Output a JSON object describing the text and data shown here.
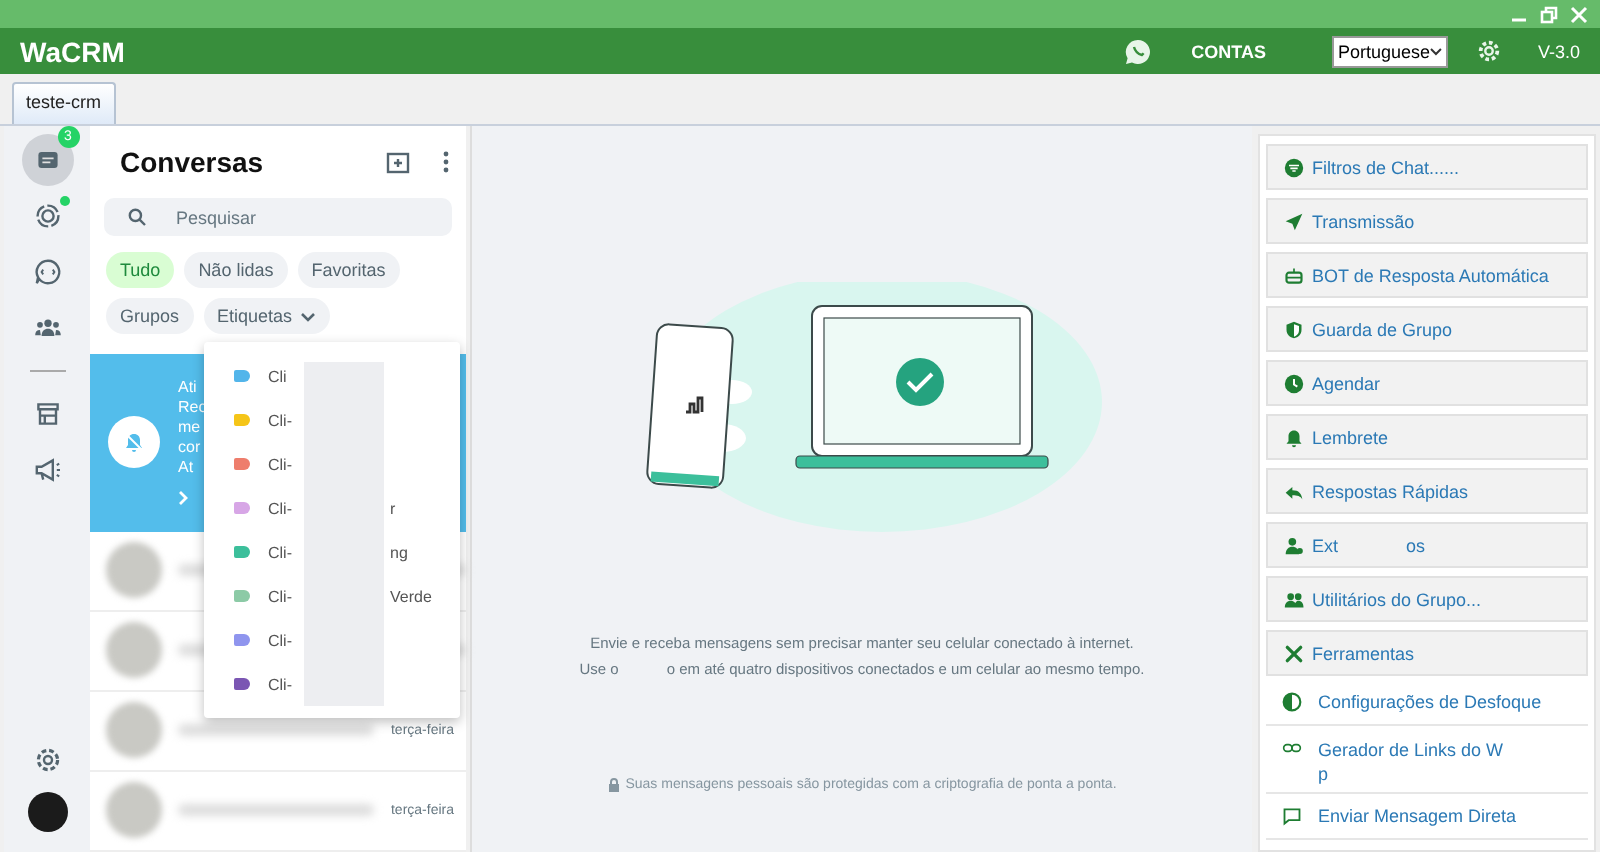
{
  "window": {
    "title": "WaCRM"
  },
  "header": {
    "contas": "CONTAS",
    "language": "Portuguese",
    "version": "V-3.0"
  },
  "tabs": [
    {
      "label": "teste-crm",
      "selected": true
    }
  ],
  "rail": {
    "items": [
      {
        "kind": "chats",
        "selected": true,
        "badge": "3"
      },
      {
        "kind": "status",
        "selected": false,
        "dot": true
      },
      {
        "kind": "channels",
        "selected": false
      },
      {
        "kind": "communities",
        "selected": false
      },
      {
        "kind": "store",
        "selected": false
      },
      {
        "kind": "megaphone",
        "selected": false
      }
    ]
  },
  "chat_panel": {
    "title": "Conversas",
    "search": {
      "placeholder": "Pesquisar"
    },
    "filters": [
      {
        "label": "Tudo",
        "selected": true,
        "dropdown": false
      },
      {
        "label": "Não lidas",
        "selected": false,
        "dropdown": false
      },
      {
        "label": "Favoritas",
        "selected": false,
        "dropdown": false
      },
      {
        "label": "Grupos",
        "selected": false,
        "dropdown": false
      },
      {
        "label": "Etiquetas",
        "selected": false,
        "dropdown": true
      }
    ],
    "banner_lines": [
      "Ati",
      "Rec",
      "me",
      "cor",
      "At"
    ],
    "chats": [
      {
        "kind": "blurred"
      },
      {
        "kind": "blurred"
      },
      {
        "kind": "blurred",
        "time": "terça-feira"
      },
      {
        "kind": "blurred",
        "time": "terça-feira"
      }
    ],
    "labels_menu": [
      {
        "text": "Cli",
        "color": "#53b5ea"
      },
      {
        "text": "Cli-",
        "color": "#f5c518"
      },
      {
        "text": "Cli-",
        "color": "#ee7d6c"
      },
      {
        "text": "Cli-",
        "suffix": "r",
        "color": "#d7a6e6"
      },
      {
        "text": "Cli-",
        "suffix": "ng",
        "color": "#3cbf9b"
      },
      {
        "text": "Cli-",
        "suffix": "Verde",
        "color": "#8ccaa6"
      },
      {
        "text": "Cli-",
        "color": "#8f95ee"
      },
      {
        "text": "Cli-",
        "color": "#7b56b3"
      }
    ]
  },
  "main": {
    "line_1": "Envie e receba mensagens sem precisar manter seu celular conectado à internet.",
    "line_2_start": "Use o",
    "line_2_end": "o em até quatro dispositivos conectados e um celular ao mesmo tempo.",
    "footer": "Suas mensagens pessoais são protegidas com a criptografia de ponta a ponta."
  },
  "tools": [
    {
      "kind": "button",
      "label": "Filtros de Chat......"
    },
    {
      "kind": "button",
      "label": "Transmissão"
    },
    {
      "kind": "button",
      "label": "BOT de Resposta Automática"
    },
    {
      "kind": "button",
      "label": "Guarda de Grupo"
    },
    {
      "kind": "button",
      "label": "Agendar"
    },
    {
      "kind": "button",
      "label": "Lembrete"
    },
    {
      "kind": "button",
      "label": "Respostas Rápidas"
    },
    {
      "kind": "button",
      "label": "Ext",
      "tail": "os"
    },
    {
      "kind": "button",
      "label": "Utilitários do Grupo..."
    },
    {
      "kind": "button",
      "label": "Ferramentas"
    },
    {
      "kind": "link",
      "label": "Configurações de Desfoque"
    },
    {
      "kind": "link",
      "label": "Gerador de Links do W",
      "tail": "p"
    },
    {
      "kind": "link",
      "label": "Enviar Mensagem Direta"
    }
  ]
}
